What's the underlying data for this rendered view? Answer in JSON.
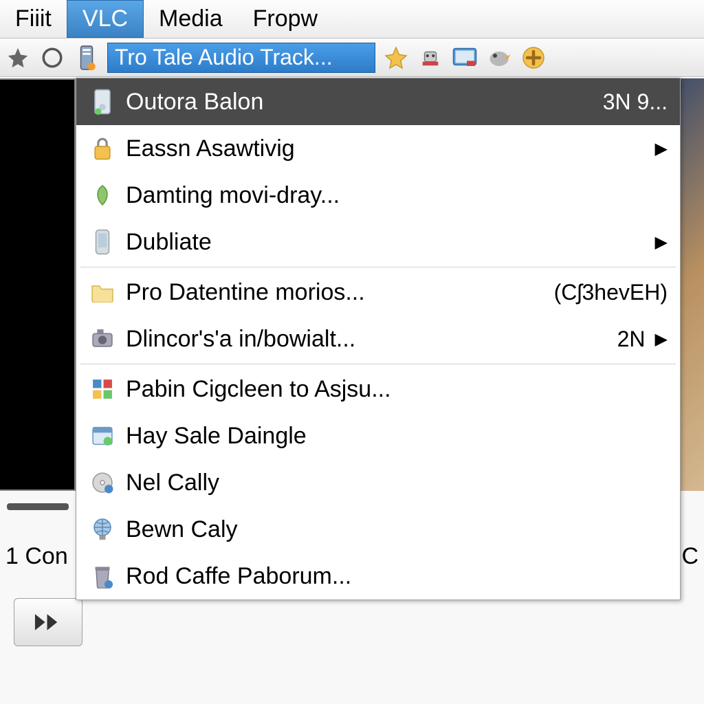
{
  "menubar": {
    "items": [
      {
        "label": "Fiiit",
        "active": false
      },
      {
        "label": "VLC",
        "active": true
      },
      {
        "label": "Media",
        "active": false
      },
      {
        "label": "Fropw",
        "active": false
      }
    ]
  },
  "toolbar": {
    "highlighted_label": "Tro Tale Audio Track..."
  },
  "dropdown": {
    "items": [
      {
        "icon": "device-icon",
        "label": "Outora Balon",
        "shortcut": "3N 9...",
        "submenu": false,
        "highlighted": true
      },
      {
        "icon": "lock-icon",
        "label": "Eassn Asawtivig",
        "shortcut": "",
        "submenu": true,
        "highlighted": false
      },
      {
        "icon": "leaf-icon",
        "label": "Damting movi-dray...",
        "shortcut": "",
        "submenu": false,
        "highlighted": false
      },
      {
        "icon": "phone-icon",
        "label": "Dubliate",
        "shortcut": "",
        "submenu": true,
        "highlighted": false
      },
      {
        "separator": true
      },
      {
        "icon": "folder-icon",
        "label": "Pro Datentine morios...",
        "shortcut": "(Cʃ3hevEH)",
        "submenu": false,
        "highlighted": false
      },
      {
        "icon": "camera-icon",
        "label": "Dlincor's'a in/bowialt...",
        "shortcut": "2N",
        "submenu": true,
        "highlighted": false
      },
      {
        "separator": true
      },
      {
        "icon": "tiles-icon",
        "label": "Pabin Cigcleen to Asjsu...",
        "shortcut": "",
        "submenu": false,
        "highlighted": false
      },
      {
        "icon": "window-icon",
        "label": "Hay Sale Daingle",
        "shortcut": "",
        "submenu": false,
        "highlighted": false
      },
      {
        "icon": "disc-icon",
        "label": "Nel Cally",
        "shortcut": "",
        "submenu": false,
        "highlighted": false
      },
      {
        "icon": "globe-icon",
        "label": "Bewn Caly",
        "shortcut": "",
        "submenu": false,
        "highlighted": false
      },
      {
        "icon": "trash-icon",
        "label": "Rod Caffe Paborum...",
        "shortcut": "",
        "submenu": false,
        "highlighted": false
      }
    ]
  },
  "bottom": {
    "left_text": "1 Con",
    "right_text": ":C"
  }
}
